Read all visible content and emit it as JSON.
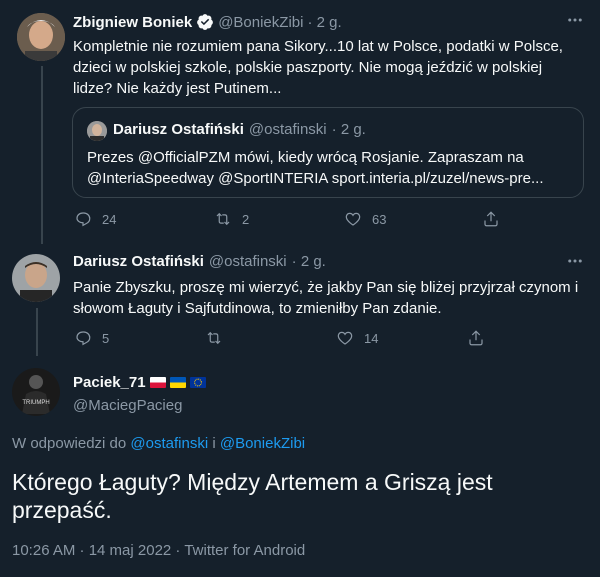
{
  "tweet1": {
    "name": "Zbigniew Boniek",
    "handle": "@BoniekZibi",
    "time": "· 2 g.",
    "text": "Kompletnie nie rozumiem pana Sikory...10 lat w Polsce, podatki w Polsce, dzieci w polskiej szkole, polskie paszporty. Nie mogą jeździć w polskiej lidze? Nie każdy jest Putinem...",
    "quote": {
      "name": "Dariusz Ostafiński",
      "handle": "@ostafinski",
      "time": "· 2 g.",
      "text_line1": "Prezes @OfficialPZM mówi, kiedy wrócą Rosjanie. Zapraszam na",
      "text_line2": "@InteriaSpeedway @SportINTERIA sport.interia.pl/zuzel/news-pre..."
    },
    "reply_count": "24",
    "retweet_count": "2",
    "like_count": "63"
  },
  "tweet2": {
    "name": "Dariusz Ostafiński",
    "handle": "@ostafinski",
    "time": "· 2 g.",
    "text": "Panie Zbyszku, proszę mi wierzyć, że jakby Pan się bliżej przyjrzał czynom i słowom Łaguty i Sajfutdinowa, to zmieniłby Pan zdanie.",
    "reply_count": "5",
    "retweet_count": "",
    "like_count": "14"
  },
  "main_tweet": {
    "name": "Paciek_71",
    "handle": "@MaciegPacieg",
    "avatar_text": "TRIUMPH",
    "reply_prefix": "W odpowiedzi do",
    "reply_user1": "@ostafinski",
    "reply_and": "i",
    "reply_user2": "@BoniekZibi",
    "text": "Którego Łaguty? Między Artemem a Griszą jest przepaść.",
    "meta": "10:26 AM · 14 maj 2022 · Twitter for Android"
  },
  "colors": {
    "background": "#15202b",
    "text": "#f7f9f9",
    "muted": "#8b98a5",
    "link": "#1d9bf0",
    "border": "#38444d"
  }
}
